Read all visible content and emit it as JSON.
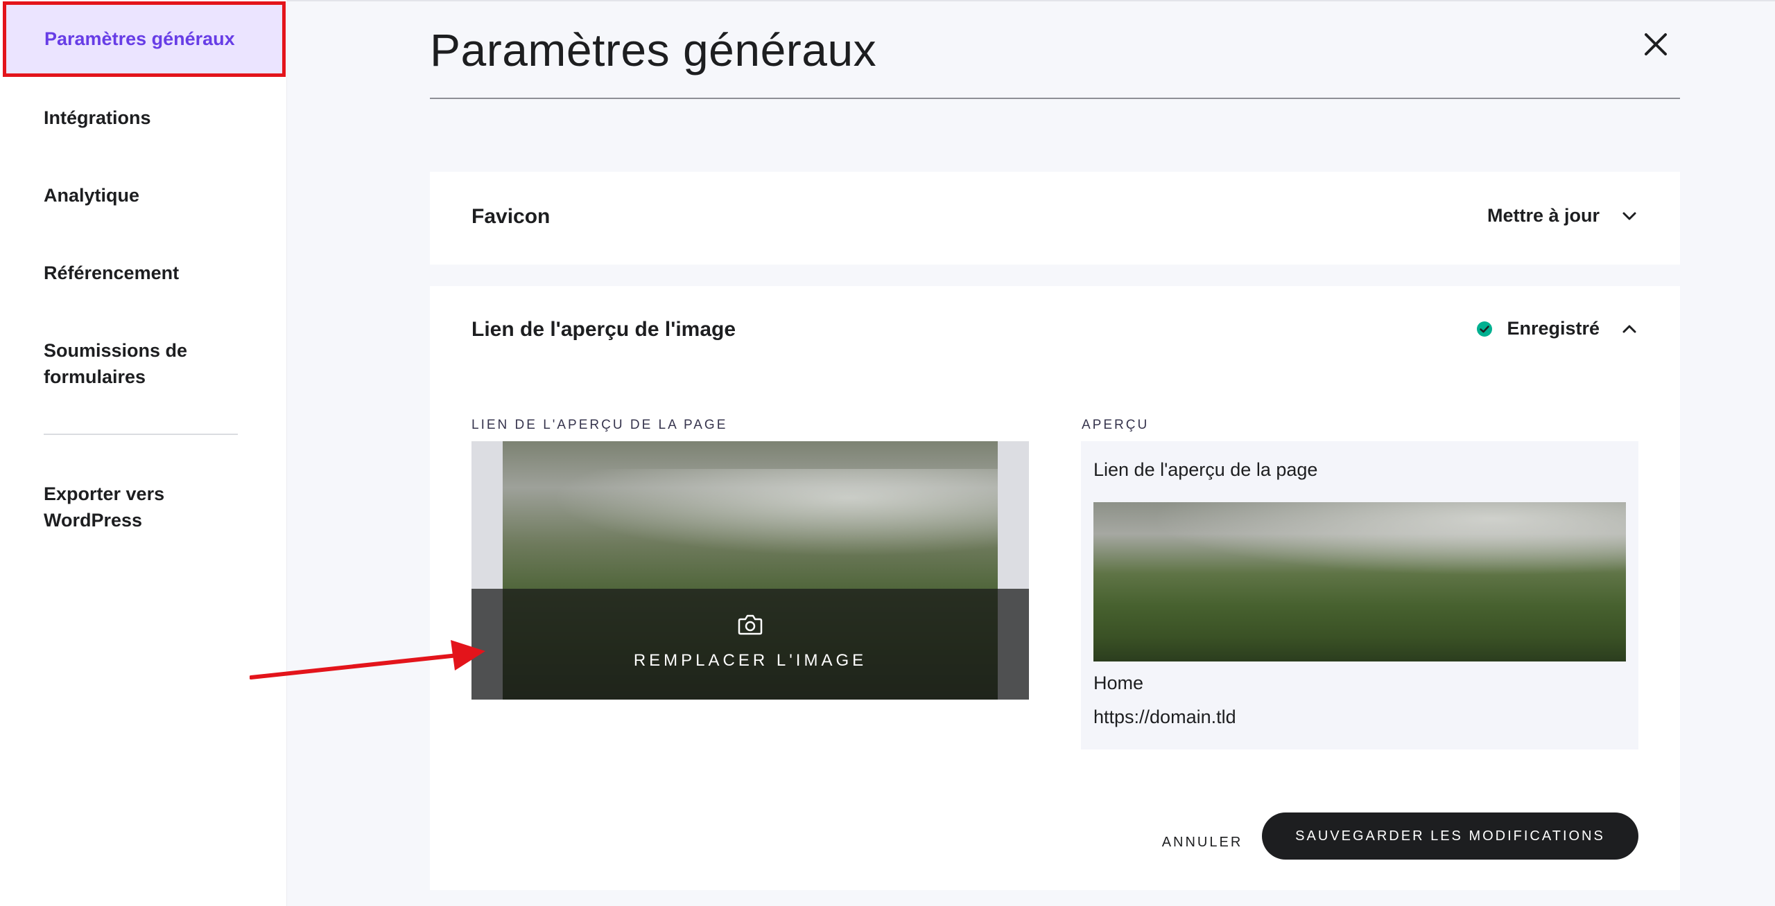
{
  "sidebar": {
    "items": [
      {
        "label": "Paramètres généraux",
        "active": true
      },
      {
        "label": "Intégrations"
      },
      {
        "label": "Analytique"
      },
      {
        "label": "Référencement"
      },
      {
        "label": "Soumissions de formulaires"
      },
      {
        "label": "Exporter vers WordPress"
      }
    ]
  },
  "header": {
    "title": "Paramètres généraux",
    "close_icon": "close-icon"
  },
  "favicon_card": {
    "title": "Favicon",
    "action_label": "Mettre à jour",
    "action_icon": "chevron-down-icon"
  },
  "preview_card": {
    "title": "Lien de l'aperçu de l'image",
    "status_label": "Enregistré",
    "status_icon": "check-circle-icon",
    "status_color": "#00b090",
    "toggle_icon": "chevron-up-icon",
    "left_label": "LIEN DE L'APERÇU DE LA PAGE",
    "right_label": "APERÇU",
    "replace_image_label": "REMPLACER L'IMAGE",
    "replace_icon": "camera-icon",
    "preview": {
      "heading": "Lien de l'aperçu de la page",
      "page_name": "Home",
      "url": "https://domain.tld"
    },
    "cancel_label": "ANNULER",
    "save_label": "SAUVEGARDER LES MODIFICATIONS"
  },
  "colors": {
    "accent": "#673de6",
    "active_bg": "#ebe4ff",
    "annotation_red": "#e3141b",
    "primary_button": "#1d1e20"
  }
}
